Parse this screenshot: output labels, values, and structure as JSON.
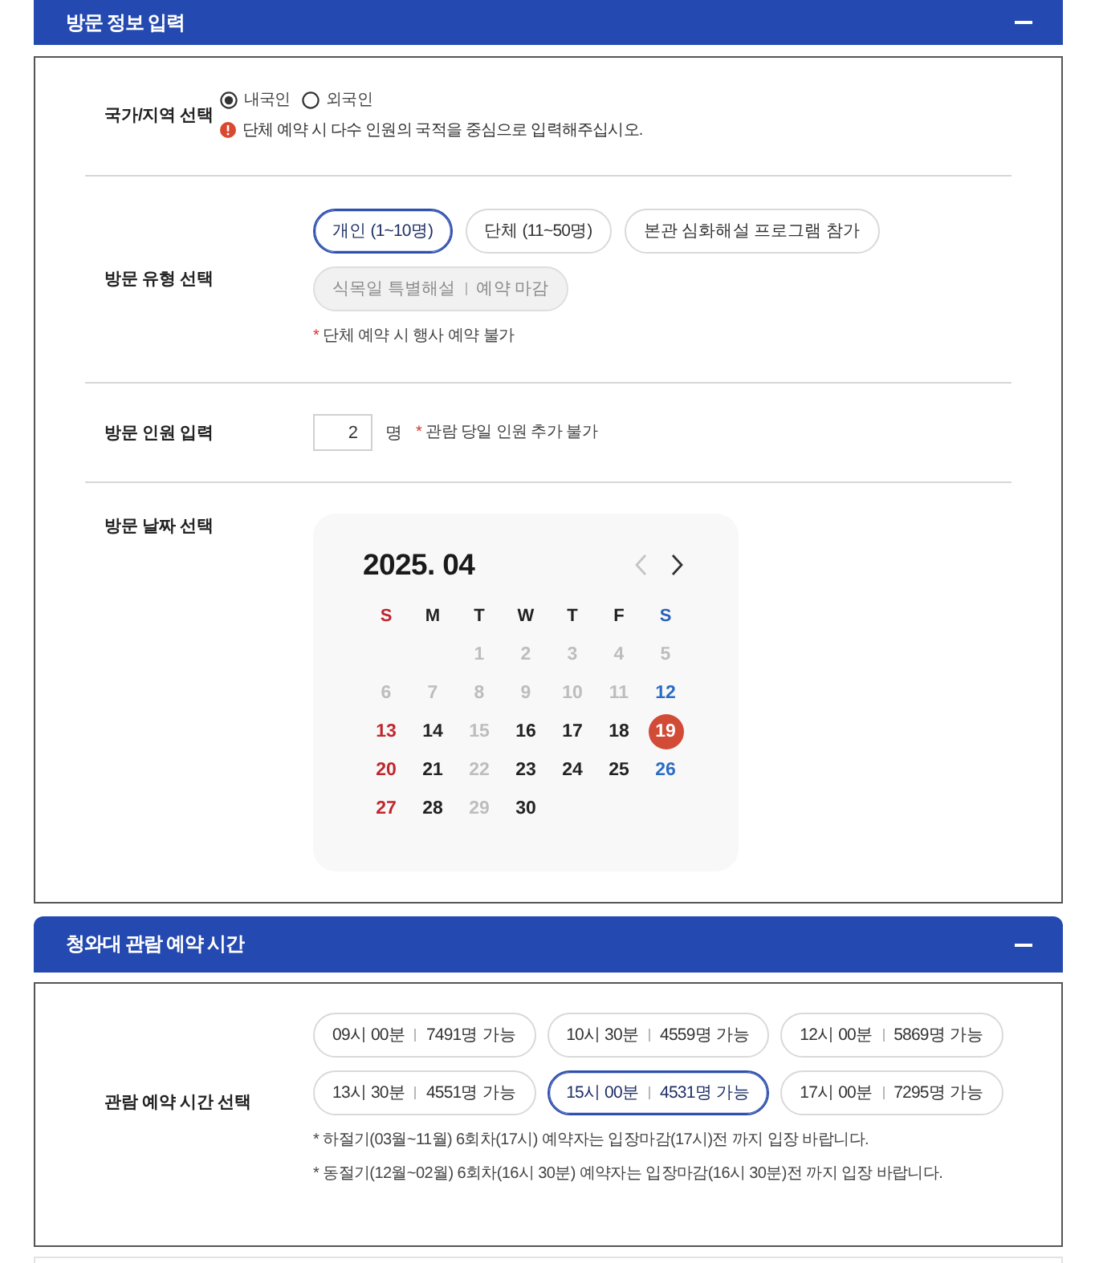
{
  "sections": [
    {
      "title": "방문 정보 입력",
      "expanded": true,
      "rows": [
        {
          "kind": "radio",
          "label": "국가/지역 선택",
          "options": [
            {
              "label": "내국인",
              "selected": true
            },
            {
              "label": "외국인",
              "selected": false
            }
          ],
          "notice": "단체 예약 시 다수 인원의 국적을 중심으로 입력해주십시오."
        },
        {
          "kind": "chips",
          "label": "방문 유형 선택",
          "options": [
            {
              "label": "개인 (1~10명)",
              "selected": true,
              "disabled": false
            },
            {
              "label": "단체 (11~50명)",
              "selected": false,
              "disabled": false
            },
            {
              "label": "본관 심화해설 프로그램 참가",
              "selected": false,
              "disabled": false
            },
            {
              "label": "식목일 특별해설",
              "status": "예약 마감",
              "selected": false,
              "disabled": true
            }
          ],
          "notes": [
            {
              "kind": "alert",
              "mark": "*",
              "text": "단체 예약 시 행사 예약 불가"
            }
          ]
        },
        {
          "kind": "count",
          "label": "방문 인원 입력",
          "value": "2",
          "unit": "명",
          "notes": [
            {
              "kind": "alert",
              "mark": "*",
              "text": "관람 당일 인원 추가 불가"
            }
          ]
        },
        {
          "kind": "calendar",
          "label": "방문 날짜 선택",
          "calendar": {
            "title": "2025. 04",
            "prev": {
              "disabled": true
            },
            "next": {
              "disabled": false
            },
            "weekdays": [
              "S",
              "M",
              "T",
              "W",
              "T",
              "F",
              "S"
            ],
            "weeks": [
              [
                {
                  "day": "1",
                  "disabled": true,
                  "selected": false
                },
                {
                  "day": "2",
                  "disabled": true,
                  "selected": false
                },
                {
                  "day": "3",
                  "disabled": true,
                  "selected": false
                },
                {
                  "day": "4",
                  "disabled": true,
                  "selected": false
                },
                {
                  "day": "5",
                  "disabled": true,
                  "selected": false
                }
              ],
              [
                {
                  "day": "6",
                  "disabled": true,
                  "selected": false
                },
                {
                  "day": "7",
                  "disabled": true,
                  "selected": false
                },
                {
                  "day": "8",
                  "disabled": true,
                  "selected": false
                },
                {
                  "day": "9",
                  "disabled": true,
                  "selected": false
                },
                {
                  "day": "10",
                  "disabled": true,
                  "selected": false
                },
                {
                  "day": "11",
                  "disabled": true,
                  "selected": false
                },
                {
                  "day": "12",
                  "disabled": false,
                  "selected": false
                }
              ],
              [
                {
                  "day": "13",
                  "disabled": false,
                  "selected": false
                },
                {
                  "day": "14",
                  "disabled": false,
                  "selected": false
                },
                {
                  "day": "15",
                  "disabled": true,
                  "selected": false
                },
                {
                  "day": "16",
                  "disabled": false,
                  "selected": false
                },
                {
                  "day": "17",
                  "disabled": false,
                  "selected": false
                },
                {
                  "day": "18",
                  "disabled": false,
                  "selected": false
                },
                {
                  "day": "19",
                  "disabled": false,
                  "selected": true
                }
              ],
              [
                {
                  "day": "20",
                  "disabled": false,
                  "selected": false
                },
                {
                  "day": "21",
                  "disabled": false,
                  "selected": false
                },
                {
                  "day": "22",
                  "disabled": true,
                  "selected": false
                },
                {
                  "day": "23",
                  "disabled": false,
                  "selected": false
                },
                {
                  "day": "24",
                  "disabled": false,
                  "selected": false
                },
                {
                  "day": "25",
                  "disabled": false,
                  "selected": false
                },
                {
                  "day": "26",
                  "disabled": false,
                  "selected": false
                }
              ],
              [
                {
                  "day": "27",
                  "disabled": false,
                  "selected": false
                },
                {
                  "day": "28",
                  "disabled": false,
                  "selected": false
                },
                {
                  "day": "29",
                  "disabled": true,
                  "selected": false
                },
                {
                  "day": "30",
                  "disabled": false,
                  "selected": false
                }
              ]
            ]
          }
        }
      ]
    },
    {
      "title": "청와대 관람 예약 시간",
      "expanded": true,
      "rows": [
        {
          "kind": "slots",
          "label": "관람 예약 시간 선택",
          "slots": [
            {
              "time": "09시 00분",
              "availability": "7491명 가능",
              "selected": false
            },
            {
              "time": "10시 30분",
              "availability": "4559명 가능",
              "selected": false
            },
            {
              "time": "12시 00분",
              "availability": "5869명 가능",
              "selected": false
            },
            {
              "time": "13시 30분",
              "availability": "4551명 가능",
              "selected": false
            },
            {
              "time": "15시 00분",
              "availability": "4531명 가능",
              "selected": true
            },
            {
              "time": "17시 00분",
              "availability": "7295명 가능",
              "selected": false
            }
          ],
          "notes": [
            {
              "kind": "plain",
              "mark": "*",
              "text": "하절기(03월~11월) 6회차(17시) 예약자는 입장마감(17시)전 까지 입장 바랍니다."
            },
            {
              "kind": "plain",
              "mark": "*",
              "text": "동절기(12월~02월) 6회차(16시 30분) 예약자는 입장마감(16시 30분)전 까지 입장 바랍니다."
            }
          ]
        }
      ]
    }
  ]
}
